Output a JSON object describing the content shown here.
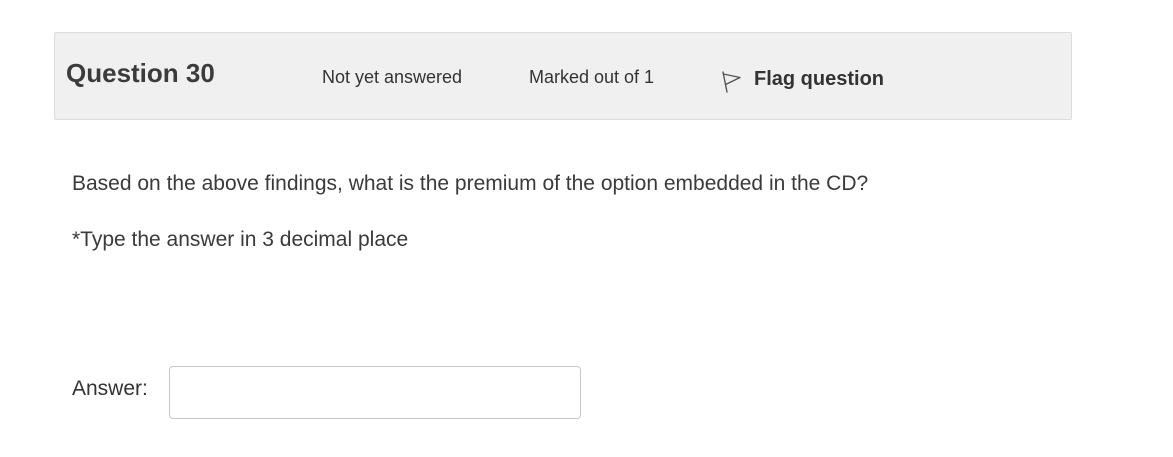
{
  "question": {
    "title": "Question 30",
    "status": "Not yet answered",
    "marks": "Marked out of 1",
    "flag_label": "Flag question",
    "flag_icon": "flag-outline-icon"
  },
  "body": {
    "text": "Based on the above findings, what is the premium of the option embedded in the CD?",
    "note": "*Type the answer in 3 decimal place"
  },
  "answer": {
    "label": "Answer:",
    "value": "",
    "placeholder": ""
  }
}
